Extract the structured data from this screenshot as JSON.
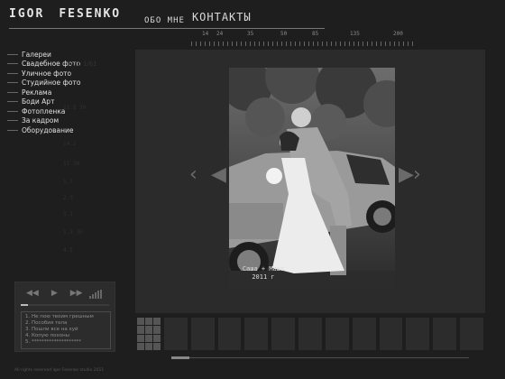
{
  "header": {
    "brand_first": "IGOR",
    "brand_last": "FESENKO",
    "nav": {
      "about": "ОБО МНЕ",
      "contacts": "КОНТАКТЫ"
    }
  },
  "ruler": {
    "labels": [
      "14",
      "24",
      "35",
      "50",
      "85",
      "135",
      "200"
    ]
  },
  "sidebar": {
    "items": [
      {
        "label": "Галереи",
        "ghost": ""
      },
      {
        "label": "Свадебное фото",
        "ghost": "7/11 1/61"
      },
      {
        "label": "Уличное фото",
        "ghost": ""
      },
      {
        "label": "Студийное фото",
        "ghost": ""
      },
      {
        "label": "Реклама",
        "ghost": ""
      },
      {
        "label": "Боди Арт",
        "ghost": ""
      },
      {
        "label": "Фотопленка",
        "ghost": ""
      },
      {
        "label": "За кадром",
        "ghost": ""
      },
      {
        "label": "Оборудование",
        "ghost": ""
      }
    ],
    "ghost_numbers": [
      "11.8 30",
      "14.2",
      "11 30",
      "1 7",
      "2.9",
      "3.1",
      "1.3 30",
      "4.5"
    ]
  },
  "player": {
    "controls": {
      "prev": "◀◀",
      "play": "▶",
      "next": "▶▶"
    },
    "progress": 0.08,
    "tracks": [
      "1. Не пою твоим грешным",
      "2. Пособия тела",
      "3. Пошли все на хуй",
      "4. Копую похоны",
      "5. ********************"
    ]
  },
  "viewer": {
    "caption_line1": "Саша + Маша",
    "caption_line2": "2011 г",
    "arrows": {
      "prev": "‹",
      "next": "›"
    }
  },
  "thumbnails": {
    "count": 12
  },
  "footer": {
    "text": "All rights reserved Igor Fesenko studio 2011"
  },
  "colors": {
    "background": "#1e1e1e",
    "panel": "#2b2b2b",
    "text": "#e0e0e0"
  }
}
